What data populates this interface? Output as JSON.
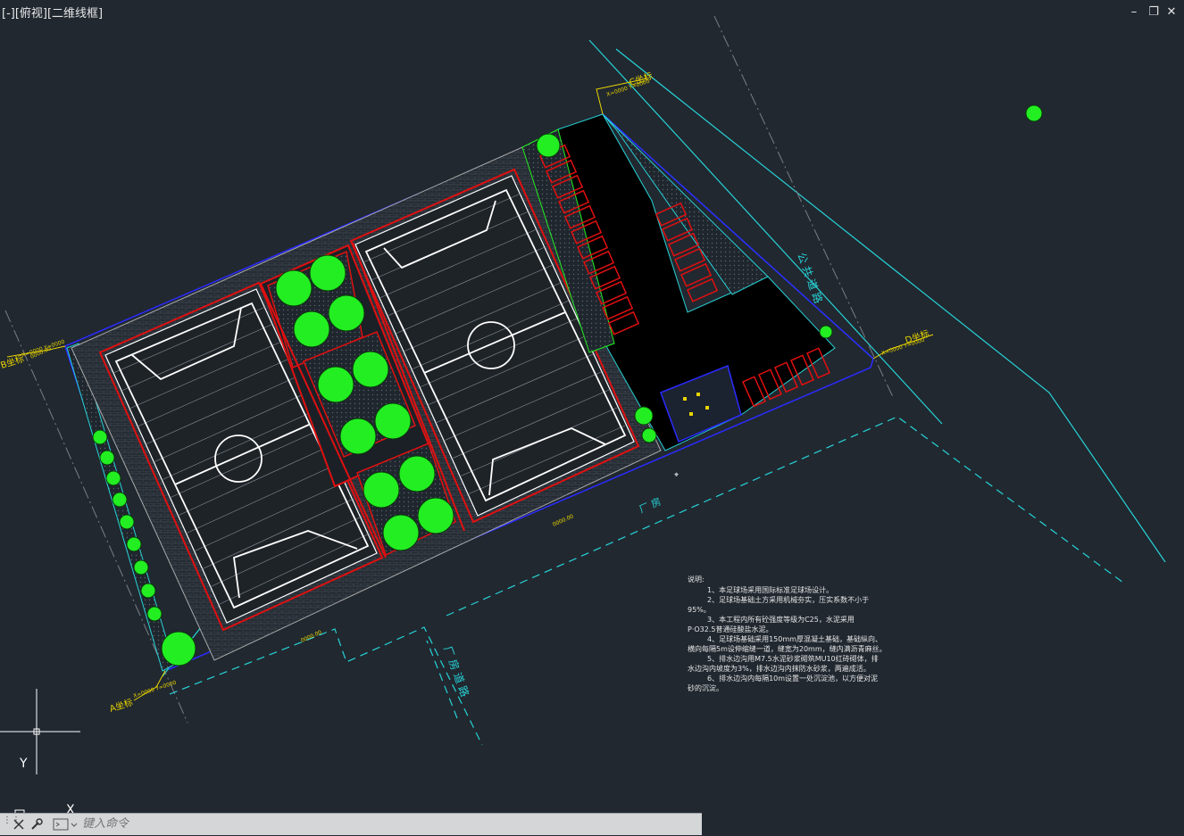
{
  "viewport": {
    "label": "[-][俯视][二维线框]"
  },
  "window_controls": {
    "minimize": "–",
    "restore": "❐",
    "close": "✕"
  },
  "drawing": {
    "coord_labels": {
      "a": "A坐标",
      "b": "B坐标",
      "c": "C坐标",
      "d": "D坐标"
    },
    "coord_values": {
      "a": "X=0000 Y=0000",
      "b": "X=0000 Y=0000",
      "c": "X=0000 Y=0000",
      "d": "X=0000 Y=0000"
    },
    "road_public": "公 共 道 路",
    "road_factory": "厂 房 道 路",
    "building_label": "厂 房",
    "dimension_labels": [
      "0000.00",
      "0000.00",
      "0000.00"
    ],
    "notes": {
      "title": "说明:",
      "lines": [
        "1、本足球场采用国际标准足球场设计。",
        "2、足球场基础土方采用机械夯实，压实系数不小于",
        "95%。",
        "3、本工程内所有砼强度等级为C25，水泥采用",
        "P·O32.5普通硅酸盐水泥。",
        "4、足球场基础采用150mm厚混凝土基础，基础纵向、",
        "横向每隔5m设伸缩缝一道，缝宽为20mm，缝内满沥青麻丝。",
        "5、排水边沟用M7.5水泥砂浆砌筑MU10红砖砌体，排",
        "水边沟内坡度为3%，排水边沟内抹防水砂浆，两遍成活。",
        "6、排水边沟内每隔10m设置一处沉淀池，以方便对泥",
        "砂的沉淀。"
      ]
    },
    "ucs_y": "Y",
    "ucs_x": "X"
  },
  "command_line": {
    "placeholder": "键入命令"
  },
  "colors": {
    "background": "#212830",
    "cyan": "#27d3d7",
    "red": "#e01010",
    "green": "#22ee22",
    "yellow": "#e8d400",
    "blue": "#2b2bff",
    "white": "#ffffff"
  }
}
